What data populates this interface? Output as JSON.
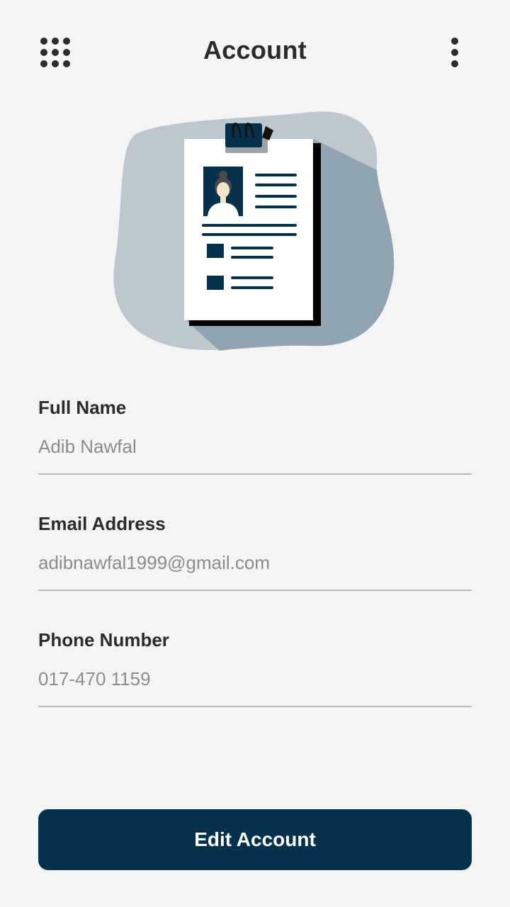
{
  "header": {
    "title": "Account",
    "menu_icon": "apps-grid-icon",
    "more_icon": "more-vertical-icon"
  },
  "illustration": {
    "subject": "profile-card-icon"
  },
  "form": {
    "fields": [
      {
        "label": "Full Name",
        "value": "Adib Nawfal"
      },
      {
        "label": "Email Address",
        "value": "adibnawfal1999@gmail.com"
      },
      {
        "label": "Phone Number",
        "value": "017-470 1159"
      }
    ],
    "submit_label": "Edit Account"
  },
  "colors": {
    "primary": "#05314c",
    "background": "#f4f4f4",
    "text": "#2b2b2b",
    "muted": "#8c8c8c"
  }
}
